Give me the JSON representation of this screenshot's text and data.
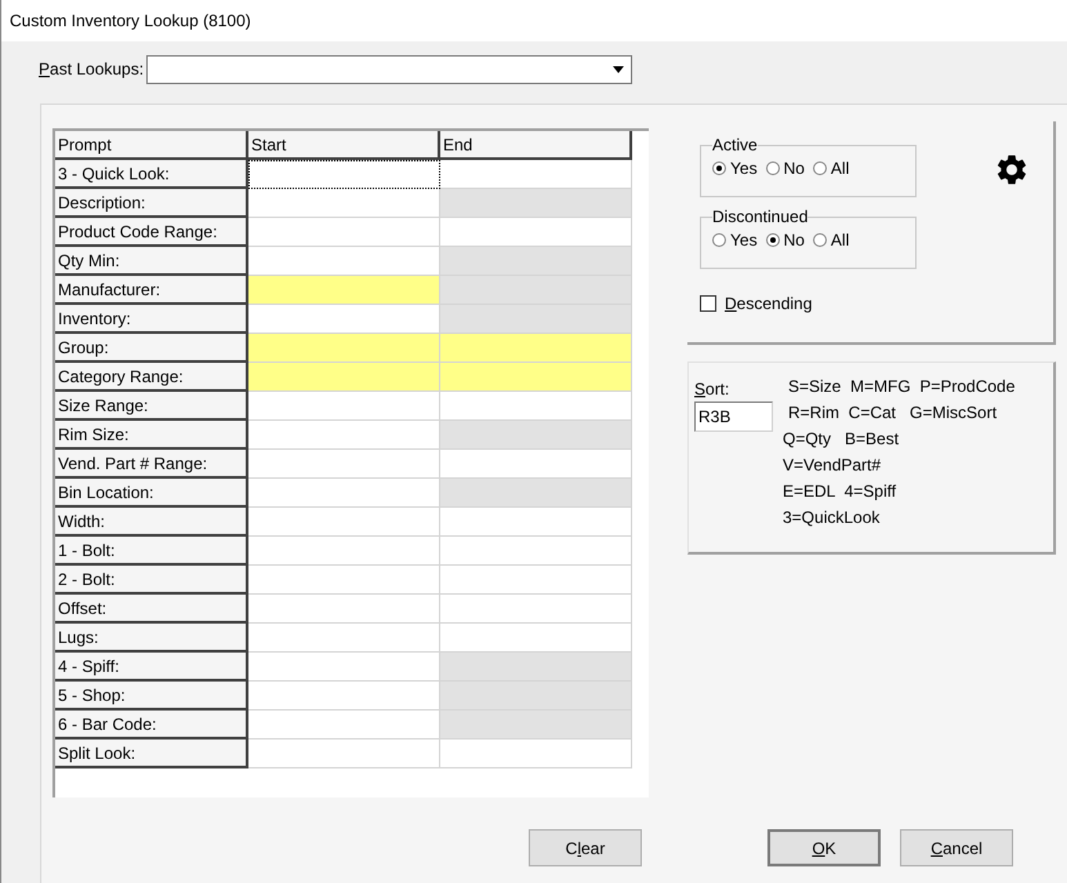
{
  "window": {
    "title": "Custom Inventory Lookup (8100)"
  },
  "past_lookups": {
    "label": {
      "key": "P",
      "post": "ast Lookups:"
    }
  },
  "grid": {
    "columns": [
      "Prompt",
      "Start",
      "End"
    ],
    "rows": [
      {
        "prompt": "3 - Quick Look:",
        "start_focused": true,
        "start_highlight": false,
        "end_highlight": false,
        "end_disabled": false
      },
      {
        "prompt": "Description:",
        "start_focused": false,
        "start_highlight": false,
        "end_highlight": false,
        "end_disabled": true
      },
      {
        "prompt": "Product Code Range:",
        "start_focused": false,
        "start_highlight": false,
        "end_highlight": false,
        "end_disabled": false
      },
      {
        "prompt": "Qty Min:",
        "start_focused": false,
        "start_highlight": false,
        "end_highlight": false,
        "end_disabled": true
      },
      {
        "prompt": "Manufacturer:",
        "start_focused": false,
        "start_highlight": true,
        "end_highlight": false,
        "end_disabled": true
      },
      {
        "prompt": "Inventory:",
        "start_focused": false,
        "start_highlight": false,
        "end_highlight": false,
        "end_disabled": true
      },
      {
        "prompt": "Group:",
        "start_focused": false,
        "start_highlight": true,
        "end_highlight": true,
        "end_disabled": false
      },
      {
        "prompt": "Category Range:",
        "start_focused": false,
        "start_highlight": true,
        "end_highlight": true,
        "end_disabled": false
      },
      {
        "prompt": "Size Range:",
        "start_focused": false,
        "start_highlight": false,
        "end_highlight": false,
        "end_disabled": false
      },
      {
        "prompt": "Rim Size:",
        "start_focused": false,
        "start_highlight": false,
        "end_highlight": false,
        "end_disabled": true
      },
      {
        "prompt": "Vend. Part # Range:",
        "start_focused": false,
        "start_highlight": false,
        "end_highlight": false,
        "end_disabled": false
      },
      {
        "prompt": "Bin Location:",
        "start_focused": false,
        "start_highlight": false,
        "end_highlight": false,
        "end_disabled": true
      },
      {
        "prompt": "Width:",
        "start_focused": false,
        "start_highlight": false,
        "end_highlight": false,
        "end_disabled": false
      },
      {
        "prompt": "1 - Bolt:",
        "start_focused": false,
        "start_highlight": false,
        "end_highlight": false,
        "end_disabled": false
      },
      {
        "prompt": "2 - Bolt:",
        "start_focused": false,
        "start_highlight": false,
        "end_highlight": false,
        "end_disabled": false
      },
      {
        "prompt": "Offset:",
        "start_focused": false,
        "start_highlight": false,
        "end_highlight": false,
        "end_disabled": false
      },
      {
        "prompt": "Lugs:",
        "start_focused": false,
        "start_highlight": false,
        "end_highlight": false,
        "end_disabled": false
      },
      {
        "prompt": "4 - Spiff:",
        "start_focused": false,
        "start_highlight": false,
        "end_highlight": false,
        "end_disabled": true
      },
      {
        "prompt": "5 - Shop:",
        "start_focused": false,
        "start_highlight": false,
        "end_highlight": false,
        "end_disabled": true
      },
      {
        "prompt": "6 - Bar Code:",
        "start_focused": false,
        "start_highlight": false,
        "end_highlight": false,
        "end_disabled": true
      },
      {
        "prompt": "Split Look:",
        "start_focused": false,
        "start_highlight": false,
        "end_highlight": false,
        "end_disabled": false
      }
    ]
  },
  "filters": [
    {
      "title": "Active",
      "options": [
        {
          "label": "Yes",
          "selected": true
        },
        {
          "label": "No",
          "selected": false
        },
        {
          "label": "All",
          "selected": false
        }
      ]
    },
    {
      "title": "Discontinued",
      "options": [
        {
          "label": "Yes",
          "selected": false
        },
        {
          "label": "No",
          "selected": true
        },
        {
          "label": "All",
          "selected": false
        }
      ]
    }
  ],
  "descending": {
    "label": {
      "key": "D",
      "post": "escending"
    },
    "checked": false
  },
  "sort": {
    "label": {
      "key": "S",
      "post": "ort:"
    },
    "value": "R3B",
    "legend": [
      "S=Size  M=MFG  P=ProdCode",
      "R=Rim  C=Cat   G=MiscSort",
      "Q=Qty   B=Best",
      "V=VendPart#",
      "E=EDL  4=Spiff",
      "3=QuickLook"
    ]
  },
  "buttons": [
    {
      "kind": "clear",
      "label": {
        "pre": "C",
        "key": "l",
        "post": "ear"
      }
    },
    {
      "kind": "ok",
      "label": {
        "key": "O",
        "post": "K"
      }
    },
    {
      "kind": "cancel",
      "label": {
        "key": "C",
        "post": "ancel"
      }
    }
  ]
}
